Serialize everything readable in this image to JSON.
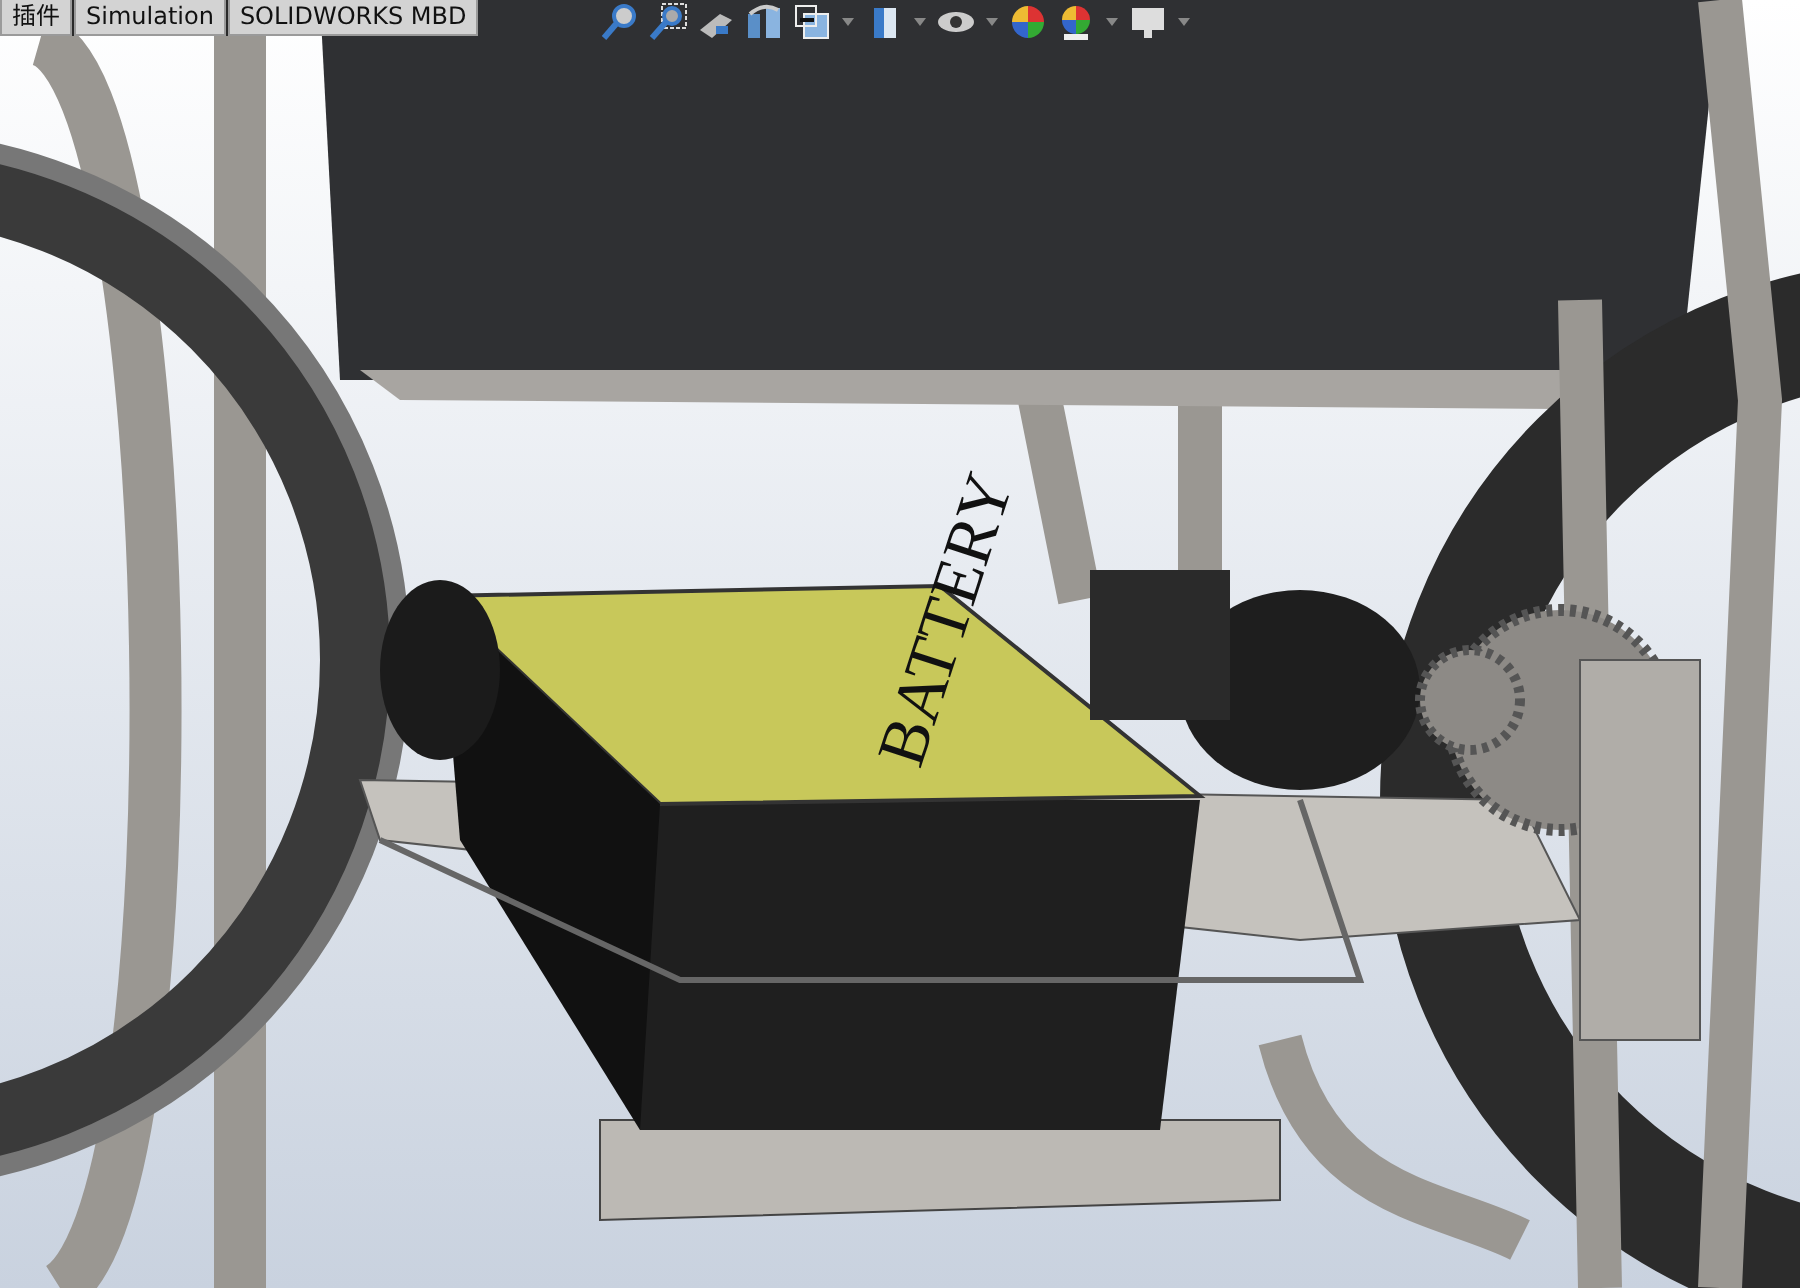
{
  "tabs": [
    {
      "label": "插件",
      "selected": false
    },
    {
      "label": "Simulation",
      "selected": false
    },
    {
      "label": "SOLIDWORKS MBD",
      "selected": false
    }
  ],
  "viewport": {
    "battery_label": "BATTERY"
  }
}
